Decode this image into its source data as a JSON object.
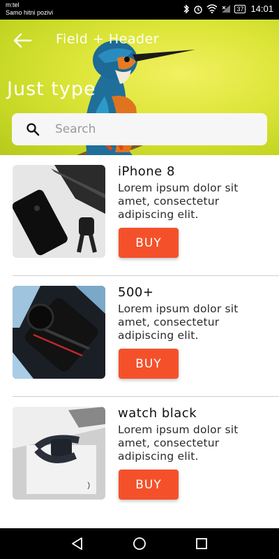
{
  "status_bar": {
    "carrier_line1": "m:tel",
    "carrier_line2": "Samo hitni pozivi",
    "battery": "37",
    "time": "14:01"
  },
  "header": {
    "title": "Field + Header",
    "big_title": "Just type",
    "search_placeholder": "Search",
    "back_icon": "arrow-left-icon",
    "background_color": "#d6e22e"
  },
  "products": [
    {
      "name": "iPhone 8",
      "description": "Lorem ipsum dolor sit amet, consectetur adipiscing elit.",
      "buy_label": "BUY"
    },
    {
      "name": "500+",
      "description": "Lorem ipsum dolor sit amet, consectetur adipiscing elit.",
      "buy_label": "BUY"
    },
    {
      "name": "watch black",
      "description": "Lorem ipsum dolor sit amet, consectetur adipiscing elit.",
      "buy_label": "BUY"
    }
  ],
  "colors": {
    "accent": "#f4512b",
    "divider": "#cfcfcf"
  }
}
